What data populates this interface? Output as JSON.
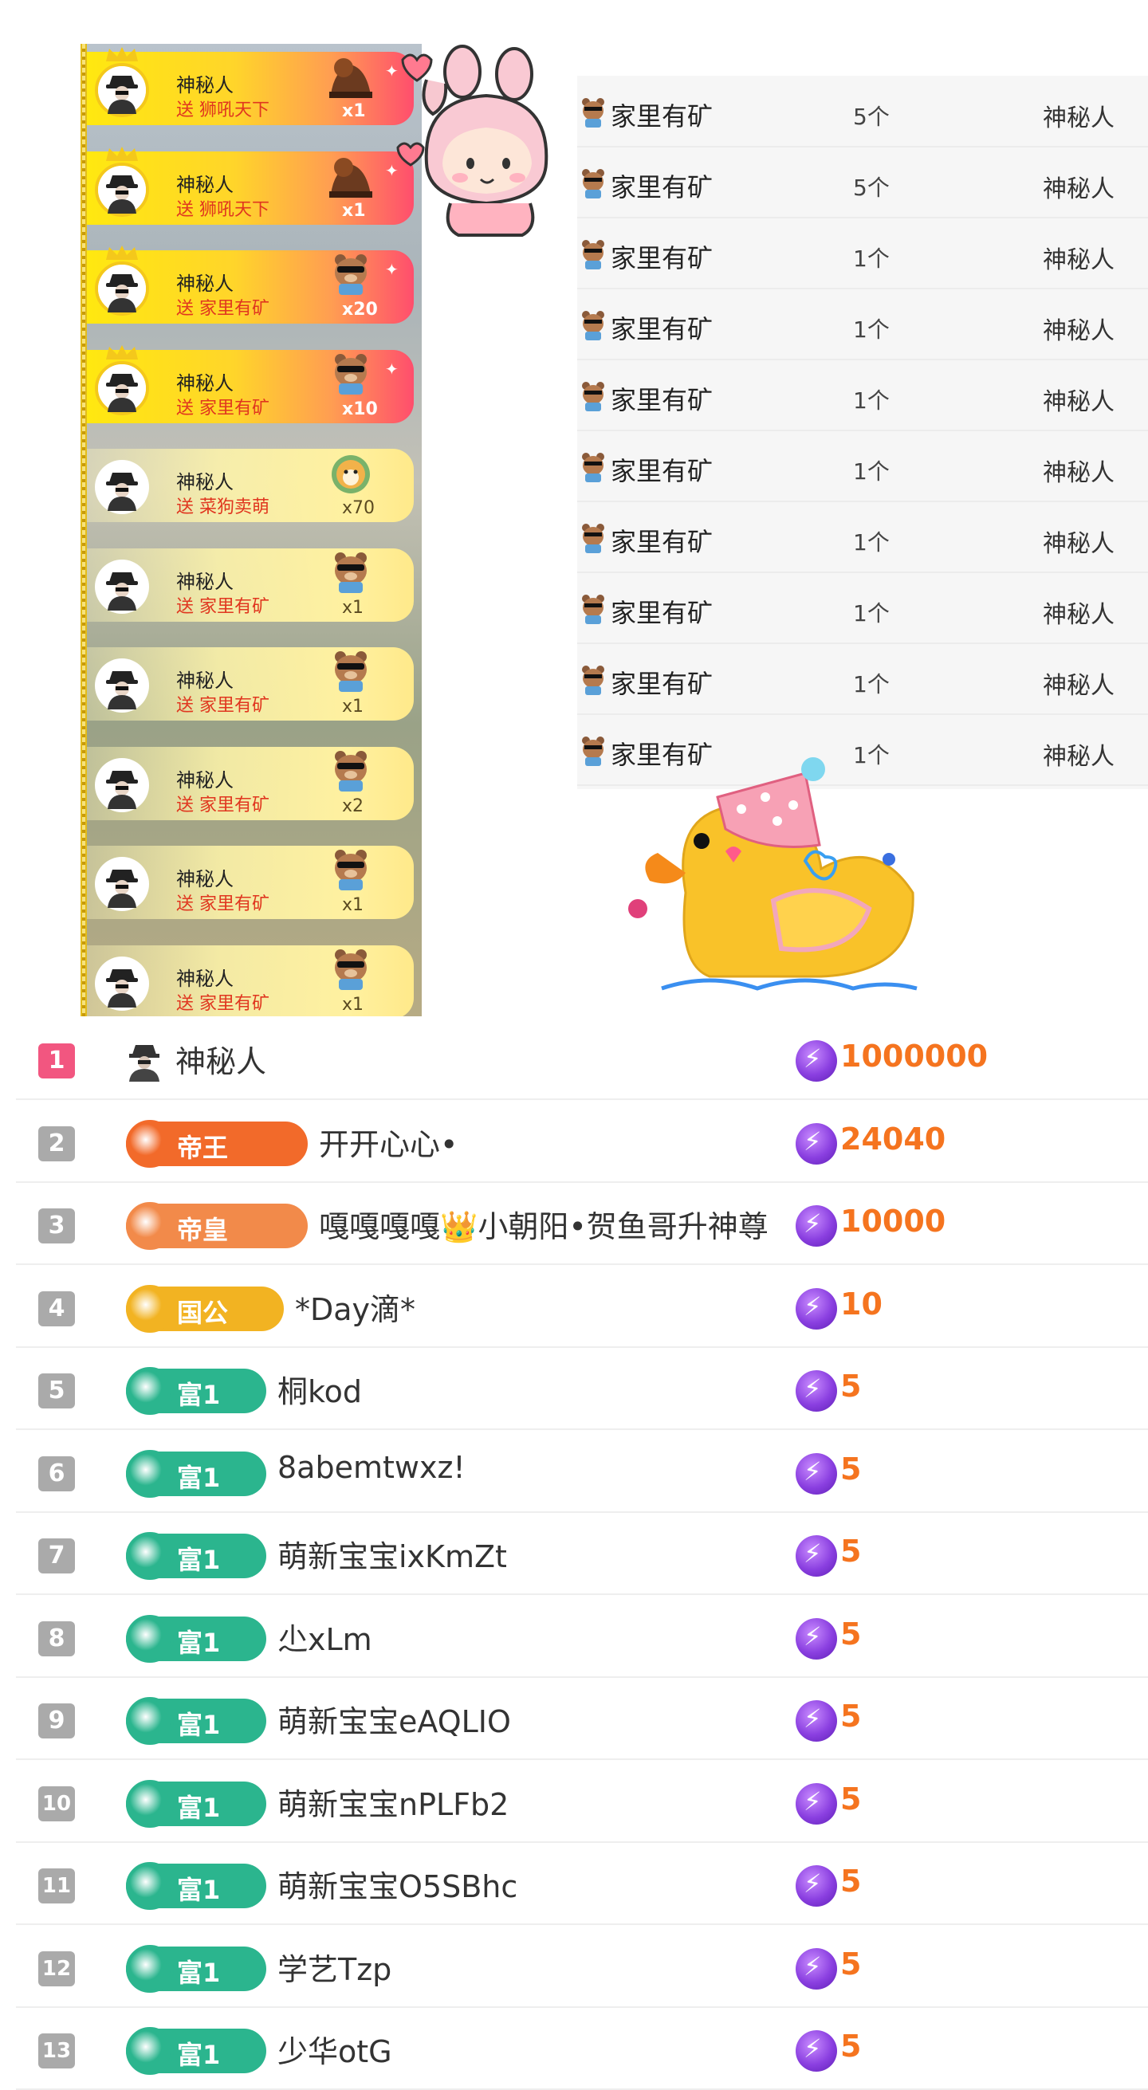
{
  "gift_feed": [
    {
      "name": "神秘人",
      "action": "送 狮吼天下",
      "count": "x1",
      "style": "vip"
    },
    {
      "name": "神秘人",
      "action": "送 狮吼天下",
      "count": "x1",
      "style": "vip"
    },
    {
      "name": "神秘人",
      "action": "送 家里有矿",
      "count": "x20",
      "style": "vip"
    },
    {
      "name": "神秘人",
      "action": "送 家里有矿",
      "count": "x10",
      "style": "vip"
    },
    {
      "name": "神秘人",
      "action": "送 菜狗卖萌",
      "count": "x70",
      "style": "norm"
    },
    {
      "name": "神秘人",
      "action": "送 家里有矿",
      "count": "x1",
      "style": "norm"
    },
    {
      "name": "神秘人",
      "action": "送 家里有矿",
      "count": "x1",
      "style": "norm"
    },
    {
      "name": "神秘人",
      "action": "送 家里有矿",
      "count": "x2",
      "style": "norm"
    },
    {
      "name": "神秘人",
      "action": "送 家里有矿",
      "count": "x1",
      "style": "norm"
    },
    {
      "name": "神秘人",
      "action": "送 家里有矿",
      "count": "x1",
      "style": "norm"
    }
  ],
  "gift_table": [
    {
      "gift": "家里有矿",
      "qty": "5个",
      "sender": "神秘人"
    },
    {
      "gift": "家里有矿",
      "qty": "5个",
      "sender": "神秘人"
    },
    {
      "gift": "家里有矿",
      "qty": "1个",
      "sender": "神秘人"
    },
    {
      "gift": "家里有矿",
      "qty": "1个",
      "sender": "神秘人"
    },
    {
      "gift": "家里有矿",
      "qty": "1个",
      "sender": "神秘人"
    },
    {
      "gift": "家里有矿",
      "qty": "1个",
      "sender": "神秘人"
    },
    {
      "gift": "家里有矿",
      "qty": "1个",
      "sender": "神秘人"
    },
    {
      "gift": "家里有矿",
      "qty": "1个",
      "sender": "神秘人"
    },
    {
      "gift": "家里有矿",
      "qty": "1个",
      "sender": "神秘人"
    },
    {
      "gift": "家里有矿",
      "qty": "1个",
      "sender": "神秘人"
    }
  ],
  "ranking": [
    {
      "rank": "1",
      "badge": "",
      "name": "神秘人",
      "value": "1000000",
      "badge_color": ""
    },
    {
      "rank": "2",
      "badge": "帝王",
      "name": "开开心心•",
      "value": "24040",
      "badge_color": "#f26a2a"
    },
    {
      "rank": "3",
      "badge": "帝皇",
      "name": "嘎嘎嘎嘎👑小朝阳•贺鱼哥升神尊",
      "value": "10000",
      "badge_color": "#f28a4a"
    },
    {
      "rank": "4",
      "badge": "国公",
      "name": "*Day滴*",
      "value": "10",
      "badge_color": "#f2b322"
    },
    {
      "rank": "5",
      "badge": "富1",
      "name": "桐kod",
      "value": "5",
      "badge_color": "#2bb58e"
    },
    {
      "rank": "6",
      "badge": "富1",
      "name": "8abemtwxz!",
      "value": "5",
      "badge_color": "#2bb58e"
    },
    {
      "rank": "7",
      "badge": "富1",
      "name": "萌新宝宝ixKmZt",
      "value": "5",
      "badge_color": "#2bb58e"
    },
    {
      "rank": "8",
      "badge": "富1",
      "name": "尐xLm",
      "value": "5",
      "badge_color": "#2bb58e"
    },
    {
      "rank": "9",
      "badge": "富1",
      "name": "萌新宝宝eAQLIO",
      "value": "5",
      "badge_color": "#2bb58e"
    },
    {
      "rank": "10",
      "badge": "富1",
      "name": "萌新宝宝nPLFb2",
      "value": "5",
      "badge_color": "#2bb58e"
    },
    {
      "rank": "11",
      "badge": "富1",
      "name": "萌新宝宝O5SBhc",
      "value": "5",
      "badge_color": "#2bb58e"
    },
    {
      "rank": "12",
      "badge": "富1",
      "name": "学艺Tzp",
      "value": "5",
      "badge_color": "#2bb58e"
    },
    {
      "rank": "13",
      "badge": "富1",
      "name": "少华otG",
      "value": "5",
      "badge_color": "#2bb58e"
    }
  ],
  "colors": {
    "value": "#f5741f",
    "rank_first": "#f25680",
    "rank_default": "#aaaaaa",
    "vip_bar": "#ffd52a"
  },
  "icons": {
    "avatar": "mystery-person-icon",
    "gift": "bear-gift-icon",
    "currency": "lightning-coin-icon"
  }
}
